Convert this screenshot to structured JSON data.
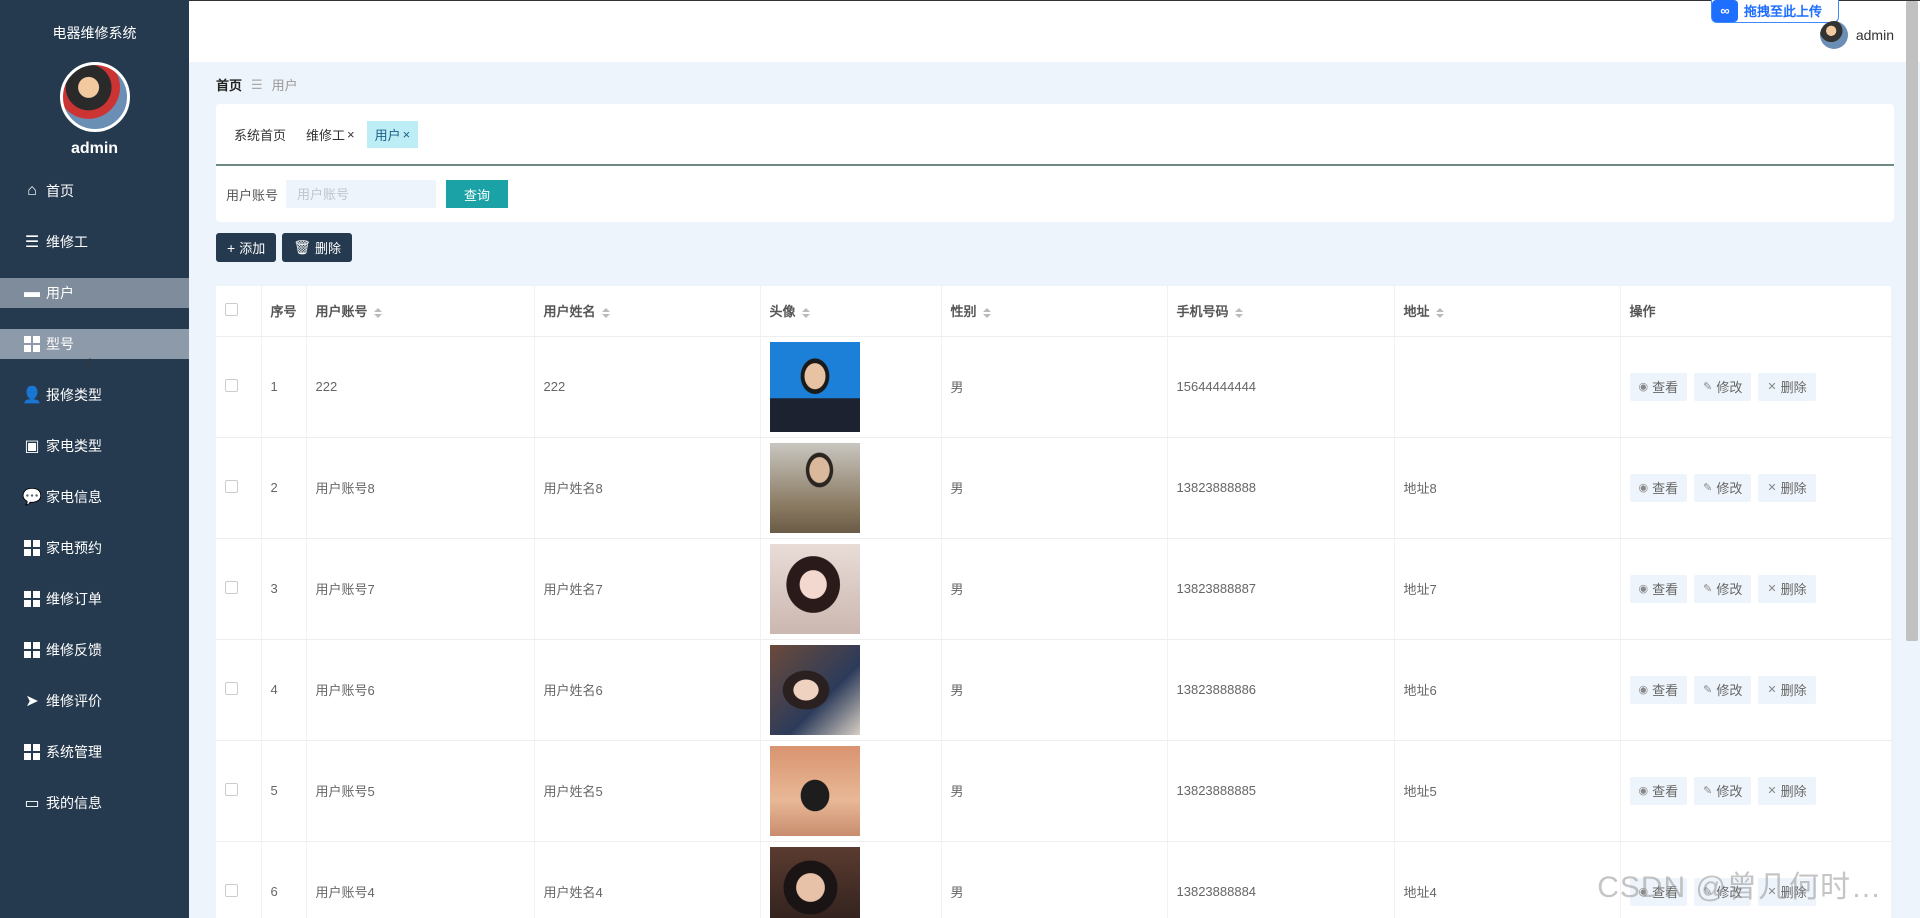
{
  "sidebar": {
    "system_title": "电器维修系统",
    "username": "admin",
    "items": [
      {
        "label": "首页",
        "icon": "home-icon"
      },
      {
        "label": "维修工",
        "icon": "sliders-icon"
      },
      {
        "label": "用户",
        "icon": "monitor-icon",
        "active": true
      },
      {
        "label": "型号",
        "icon": "grid-icon"
      },
      {
        "label": "报修类型",
        "icon": "person-icon"
      },
      {
        "label": "家电类型",
        "icon": "clipboard-icon"
      },
      {
        "label": "家电信息",
        "icon": "chat-icon"
      },
      {
        "label": "家电预约",
        "icon": "grid-icon"
      },
      {
        "label": "维修订单",
        "icon": "grid-icon"
      },
      {
        "label": "维修反馈",
        "icon": "grid-icon"
      },
      {
        "label": "维修评价",
        "icon": "send-icon"
      },
      {
        "label": "系统管理",
        "icon": "grid-icon"
      },
      {
        "label": "我的信息",
        "icon": "card-icon"
      }
    ]
  },
  "topbar": {
    "upload_label": "拖拽至此上传",
    "username": "admin"
  },
  "breadcrumb": {
    "home": "首页",
    "separator": "☰",
    "current": "用户"
  },
  "tags": [
    {
      "label": "系统首页",
      "closable": false
    },
    {
      "label": "维修工",
      "closable": true
    },
    {
      "label": "用户",
      "closable": true,
      "active": true
    }
  ],
  "tag_close_glyph": "×",
  "search": {
    "label": "用户账号",
    "placeholder": "用户账号",
    "value": "",
    "button": "查询"
  },
  "actions": {
    "add": "添加",
    "delete": "删除"
  },
  "table": {
    "columns": [
      "序号",
      "用户账号",
      "用户姓名",
      "头像",
      "性别",
      "手机号码",
      "地址",
      "操作"
    ],
    "rows": [
      {
        "index": "1",
        "account": "222",
        "name": "222",
        "gender": "男",
        "phone": "15644444444",
        "address": ""
      },
      {
        "index": "2",
        "account": "用户账号8",
        "name": "用户姓名8",
        "gender": "男",
        "phone": "13823888888",
        "address": "地址8"
      },
      {
        "index": "3",
        "account": "用户账号7",
        "name": "用户姓名7",
        "gender": "男",
        "phone": "13823888887",
        "address": "地址7"
      },
      {
        "index": "4",
        "account": "用户账号6",
        "name": "用户姓名6",
        "gender": "男",
        "phone": "13823888886",
        "address": "地址6"
      },
      {
        "index": "5",
        "account": "用户账号5",
        "name": "用户姓名5",
        "gender": "男",
        "phone": "13823888885",
        "address": "地址5"
      },
      {
        "index": "6",
        "account": "用户账号4",
        "name": "用户姓名4",
        "gender": "男",
        "phone": "13823888884",
        "address": "地址4"
      }
    ],
    "row_actions": {
      "view": "查看",
      "edit": "修改",
      "delete": "删除"
    }
  },
  "watermark": "CSDN @曾几何时…",
  "colors": {
    "sidebar_bg": "#263a4f",
    "query_button": "#1aa2a6",
    "active_tag": "#bdeef5"
  }
}
